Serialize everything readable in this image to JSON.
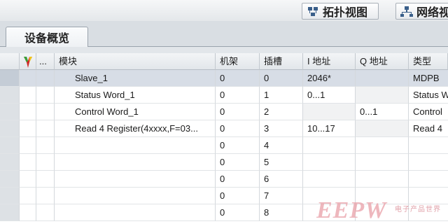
{
  "views": {
    "topology_label": "拓扑视图",
    "network_label": "网络视"
  },
  "tab": {
    "label": "设备概览"
  },
  "table": {
    "columns": {
      "more": "...",
      "module": "模块",
      "rack": "机架",
      "slot": "插槽",
      "i_addr": "I 地址",
      "q_addr": "Q 地址",
      "type": "类型"
    },
    "rows": [
      {
        "module": "Slave_1",
        "rack": "0",
        "slot": "0",
        "i_addr": "2046*",
        "q_addr": "",
        "type": "MDPB"
      },
      {
        "module": "Status Word_1",
        "rack": "0",
        "slot": "1",
        "i_addr": "0...1",
        "q_addr": "",
        "type": "Status W"
      },
      {
        "module": "Control Word_1",
        "rack": "0",
        "slot": "2",
        "i_addr": "",
        "q_addr": "0...1",
        "type": "Control"
      },
      {
        "module": "Read 4 Register(4xxxx,F=03...",
        "rack": "0",
        "slot": "3",
        "i_addr": "10...17",
        "q_addr": "",
        "type": "Read 4"
      },
      {
        "module": "",
        "rack": "0",
        "slot": "4",
        "i_addr": "",
        "q_addr": "",
        "type": ""
      },
      {
        "module": "",
        "rack": "0",
        "slot": "5",
        "i_addr": "",
        "q_addr": "",
        "type": ""
      },
      {
        "module": "",
        "rack": "0",
        "slot": "6",
        "i_addr": "",
        "q_addr": "",
        "type": ""
      },
      {
        "module": "",
        "rack": "0",
        "slot": "7",
        "i_addr": "",
        "q_addr": "",
        "type": ""
      },
      {
        "module": "",
        "rack": "0",
        "slot": "8",
        "i_addr": "",
        "q_addr": "",
        "type": ""
      }
    ]
  },
  "watermark": {
    "text": "EEPW",
    "sub": "电子产品世界"
  },
  "colors": {
    "selected_row": "#d7dde6",
    "watermark": "#e9a0a8"
  }
}
